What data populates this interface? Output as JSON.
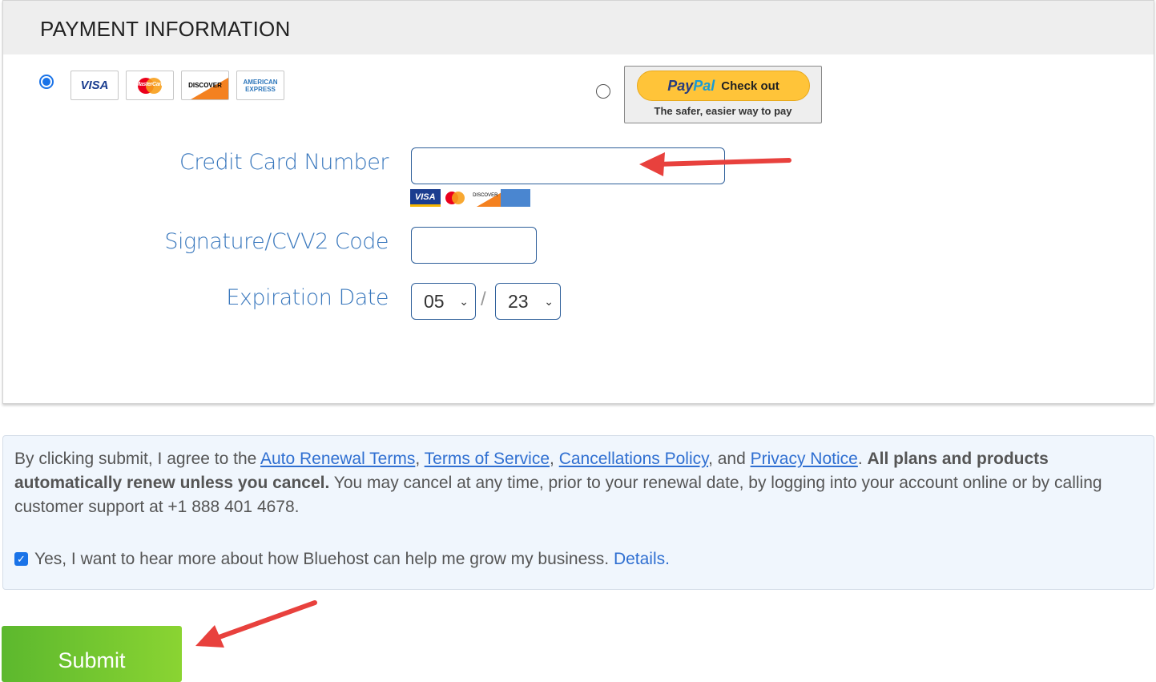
{
  "section": {
    "title": "PAYMENT INFORMATION"
  },
  "payment_methods": {
    "card_option_selected": true,
    "cards": [
      "VISA",
      "MasterCard",
      "DISCOVER",
      "AMERICAN EXPRESS"
    ],
    "paypal": {
      "logo": "PayPal",
      "button_label": "Check out",
      "tagline": "The safer, easier way to pay",
      "selected": false
    }
  },
  "form": {
    "card_number_label": "Credit Card Number",
    "card_number_value": "",
    "cvv_label": "Signature/CVV2 Code",
    "cvv_value": "",
    "expiration_label": "Expiration Date",
    "exp_month": "05",
    "exp_separator": "/",
    "exp_year": "23"
  },
  "terms": {
    "prefix": "By clicking submit, I agree to the ",
    "links": [
      "Auto Renewal Terms",
      "Terms of Service",
      "Cancellations Policy",
      "Privacy Notice"
    ],
    "and": ", and ",
    "bold": "All plans and products automatically renew unless you cancel.",
    "rest": " You may cancel at any time, prior to your renewal date, by logging into your account online or by calling customer support at +1 888 401 4678.",
    "optin_checked": true,
    "optin_text": "Yes, I want to hear more about how Bluehost can help me grow my business. ",
    "optin_link": "Details."
  },
  "submit_label": "Submit",
  "colors": {
    "accent": "#3a78bd",
    "link": "#2f6fd1",
    "submit_start": "#5cb82e",
    "submit_end": "#8ad432",
    "annotation_arrow": "#e8413d"
  }
}
